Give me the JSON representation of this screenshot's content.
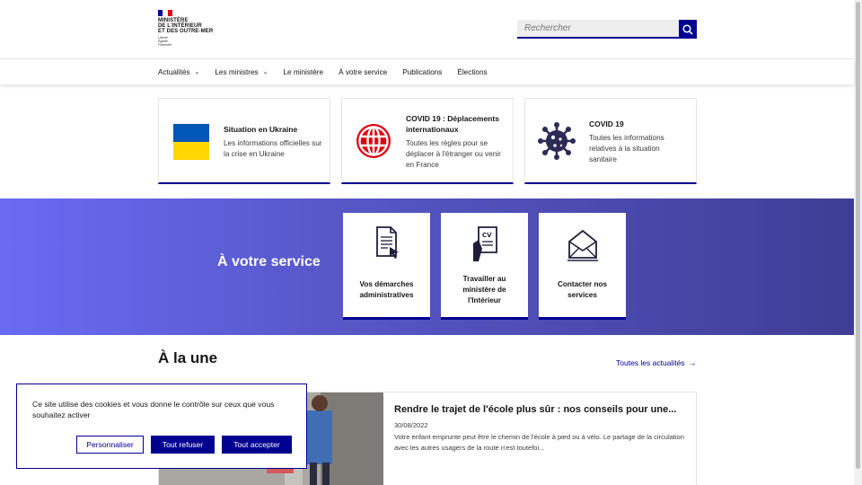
{
  "header": {
    "logo_lines": [
      "MINISTÈRE",
      "DE L'INTÉRIEUR",
      "ET DES OUTRE-MER"
    ],
    "motto_lines": [
      "Liberté",
      "Égalité",
      "Fraternité"
    ],
    "search_placeholder": "Rechercher"
  },
  "nav": {
    "items": [
      {
        "label": "Actualités",
        "has_dropdown": true
      },
      {
        "label": "Les ministres",
        "has_dropdown": true
      },
      {
        "label": "Le ministère",
        "has_dropdown": false
      },
      {
        "label": "À votre service",
        "has_dropdown": false
      },
      {
        "label": "Publications",
        "has_dropdown": false
      },
      {
        "label": "Élections",
        "has_dropdown": false
      }
    ]
  },
  "cards": [
    {
      "title": "Situation en Ukraine",
      "text": "Les informations officielles sur la crise en Ukraine",
      "icon": "ukraine-flag-icon"
    },
    {
      "title": "COVID 19 : Déplacements internationaux",
      "text": "Toutes les règles pour se déplacer à l'étranger ou venir en France",
      "icon": "globe-icon"
    },
    {
      "title": "COVID 19",
      "text": "Toutes les informations relatives à la situation sanitaire",
      "icon": "virus-icon"
    }
  ],
  "service": {
    "title": "À votre service",
    "items": [
      {
        "label": "Vos démarches administratives",
        "icon": "document-click-icon"
      },
      {
        "label": "Travailler au ministère de l'Intérieur",
        "icon": "cv-hand-icon"
      },
      {
        "label": "Contacter nos services",
        "icon": "envelope-icon"
      }
    ]
  },
  "une": {
    "title": "À la une",
    "all_news_link": "Toutes les actualités",
    "article": {
      "title": "Rendre le trajet de l'école plus sûr : nos conseils pour une...",
      "date": "30/08/2022",
      "text": "Votre enfant emprunte peut être le chemin de l'école à pied ou à vélo. Le partage de la circulation avec les autres usagers de la route n'est toutefoi..."
    }
  },
  "cookie": {
    "text": "Ce site utilise des cookies et vous donne le contrôle sur ceux que vous souhaitez activer",
    "btn_customize": "Personnaliser",
    "btn_refuse": "Tout refuser",
    "btn_accept": "Tout accepter"
  },
  "colors": {
    "primary": "#000091",
    "flag_blue": "#000091",
    "flag_red": "#e1000f",
    "ukraine_blue": "#0057b7",
    "ukraine_yellow": "#ffd700",
    "covid_red": "#e1000f",
    "virus_navy": "#2b2b56"
  }
}
